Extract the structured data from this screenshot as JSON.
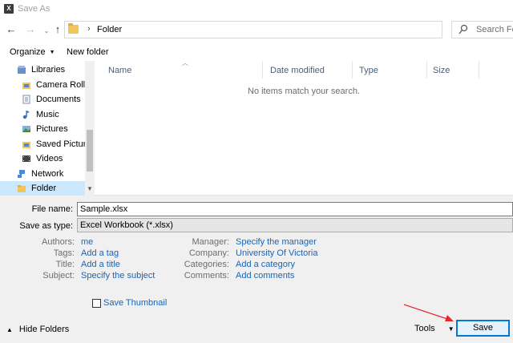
{
  "window": {
    "title": "Save As",
    "app_icon_text": "X"
  },
  "address": {
    "separator": "›",
    "folder": "Folder",
    "search_placeholder": "Search Folder"
  },
  "toolbar": {
    "organize": "Organize",
    "new_folder": "New folder"
  },
  "nav_pane": {
    "items": [
      {
        "label": "Libraries",
        "icon": "libraries-icon"
      },
      {
        "label": "Camera Roll",
        "icon": "library-folder-icon"
      },
      {
        "label": "Documents",
        "icon": "documents-icon"
      },
      {
        "label": "Music",
        "icon": "music-icon"
      },
      {
        "label": "Pictures",
        "icon": "pictures-icon"
      },
      {
        "label": "Saved Pictures",
        "icon": "library-folder-icon"
      },
      {
        "label": "Videos",
        "icon": "videos-icon"
      },
      {
        "label": "Network",
        "icon": "network-icon"
      },
      {
        "label": "Folder",
        "icon": "folder-icon"
      }
    ]
  },
  "file_list": {
    "columns": [
      "Name",
      "Date modified",
      "Type",
      "Size"
    ],
    "empty_message": "No items match your search."
  },
  "form": {
    "file_name_label": "File name:",
    "file_name_value": "Sample.xlsx",
    "save_as_type_label": "Save as type:",
    "save_as_type_value": "Excel Workbook (*.xlsx)"
  },
  "metadata": {
    "authors_label": "Authors:",
    "authors_value": "me",
    "tags_label": "Tags:",
    "tags_value": "Add a tag",
    "title_label": "Title:",
    "title_value": "Add a title",
    "subject_label": "Subject:",
    "subject_value": "Specify the subject",
    "manager_label": "Manager:",
    "manager_value": "Specify the manager",
    "company_label": "Company:",
    "company_value": "University Of Victoria",
    "categories_label": "Categories:",
    "categories_value": "Add a category",
    "comments_label": "Comments:",
    "comments_value": "Add comments"
  },
  "save_thumbnail": {
    "label": "Save Thumbnail",
    "checked": false
  },
  "footer": {
    "hide_folders": "Hide Folders",
    "tools": "Tools",
    "save": "Save"
  },
  "colors": {
    "accent": "#0078d7",
    "link": "#1a64b3",
    "selection": "#cce8ff",
    "annotation_arrow": "#e8272d"
  }
}
